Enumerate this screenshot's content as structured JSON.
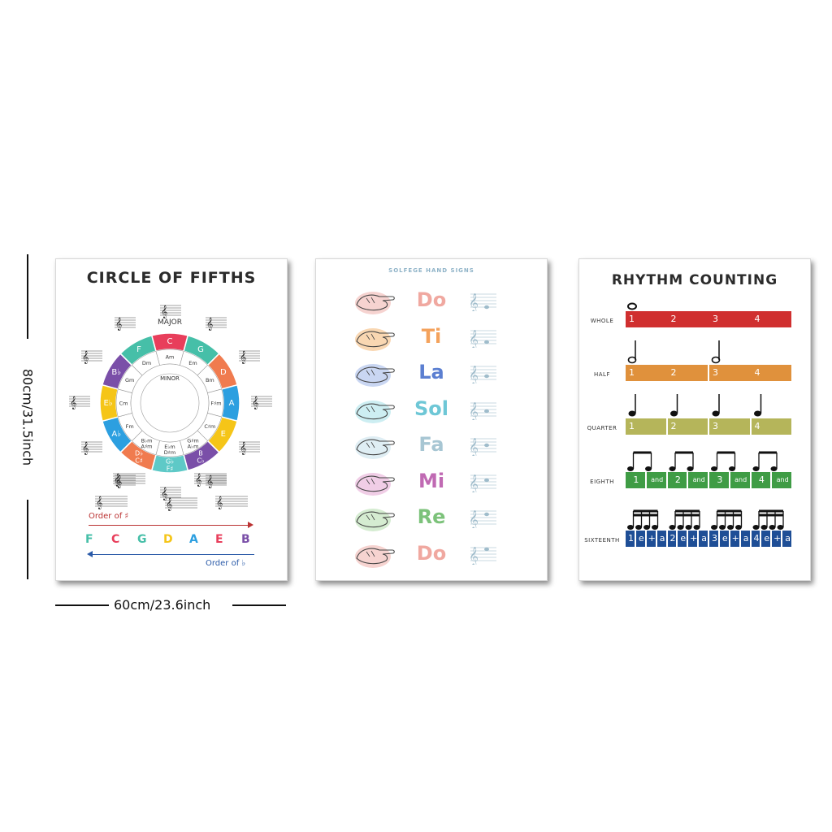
{
  "dimensions": {
    "height_label": "80cm/31.5inch",
    "width_label": "60cm/23.6inch"
  },
  "circle_of_fifths": {
    "title": "CIRCLE OF FIFTHS",
    "major_label": "MAJOR",
    "minor_label": "MINOR",
    "major_keys": [
      "C",
      "G",
      "D",
      "A",
      "E",
      "B\nC♭",
      "G♭\nF♯",
      "D♭\nC♯",
      "A♭",
      "E♭",
      "B♭",
      "F"
    ],
    "minor_keys": [
      "Am",
      "Em",
      "Bm",
      "F♯m",
      "C♯m",
      "G♯m\nA♭m",
      "E♭m\nD♯m",
      "B♭m\nA♯m",
      "Fm",
      "Cm",
      "Gm",
      "Dm"
    ],
    "major_colors": [
      "#e83e5b",
      "#46bfa8",
      "#f07b4f",
      "#2c9fe0",
      "#f5c518",
      "#7a4fa8",
      "#5ec9c7",
      "#f07b4f",
      "#2c9fe0",
      "#f5c518",
      "#7a4fa8",
      "#46bfa8"
    ],
    "order_of_sharps_label": "Order of ♯",
    "order_of_flats_label": "Order of ♭",
    "order_letters": [
      "F",
      "C",
      "G",
      "D",
      "A",
      "E",
      "B"
    ],
    "order_colors": [
      "#46bfa8",
      "#e83e5b",
      "#46bfa8",
      "#f5c518",
      "#2c9fe0",
      "#e83e5b",
      "#7a4fa8"
    ]
  },
  "solfege": {
    "title": "SOLFEGE HAND SIGNS",
    "rows": [
      {
        "syllable": "Do",
        "color": "#f0a8a0",
        "blob": "#f6d3d0"
      },
      {
        "syllable": "Ti",
        "color": "#f4a25c",
        "blob": "#f9d7b2"
      },
      {
        "syllable": "La",
        "color": "#5b7fd1",
        "blob": "#c9d6f2"
      },
      {
        "syllable": "Sol",
        "color": "#6ec7d6",
        "blob": "#cdeef2"
      },
      {
        "syllable": "Fa",
        "color": "#a7c6d3",
        "blob": "#dfeef4"
      },
      {
        "syllable": "Mi",
        "color": "#c06ab3",
        "blob": "#f0cde6"
      },
      {
        "syllable": "Re",
        "color": "#7cc27a",
        "blob": "#d5ecd1"
      },
      {
        "syllable": "Do",
        "color": "#f0a8a0",
        "blob": "#f6d3d0"
      }
    ]
  },
  "rhythm": {
    "title": "RHYTHM COUNTING",
    "rows": [
      {
        "label": "WHOLE",
        "color": "#d02f2f",
        "counts": [
          "1",
          "2",
          "3",
          "4"
        ]
      },
      {
        "label": "HALF",
        "color": "#e0913c",
        "counts": [
          "1",
          "2",
          "3",
          "4"
        ]
      },
      {
        "label": "QUARTER",
        "color": "#b5b55a",
        "counts": [
          "1",
          "2",
          "3",
          "4"
        ]
      },
      {
        "label": "EIGHTH",
        "color": "#3f9c45",
        "counts": [
          "1",
          "and",
          "2",
          "and",
          "3",
          "and",
          "4",
          "and"
        ]
      },
      {
        "label": "SIXTEENTH",
        "color": "#1e4e96",
        "counts": [
          "1",
          "e",
          "+",
          "a",
          "2",
          "e",
          "+",
          "a",
          "3",
          "e",
          "+",
          "a",
          "4",
          "e",
          "+",
          "a"
        ]
      }
    ]
  }
}
